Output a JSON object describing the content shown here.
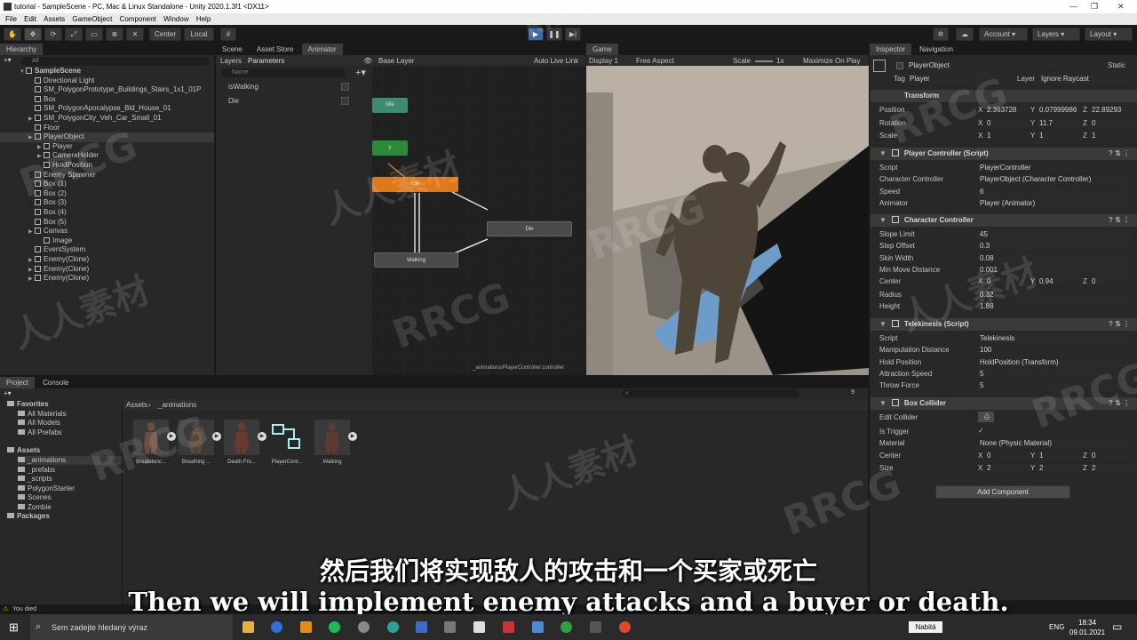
{
  "window_title": "tutorial - SampleScene - PC, Mac & Linux Standalone - Unity 2020.1.3f1 <DX11>",
  "menu": [
    "File",
    "Edit",
    "Assets",
    "GameObject",
    "Component",
    "Window",
    "Help"
  ],
  "toolbar": {
    "center": "Center",
    "local": "Local",
    "account": "Account",
    "layers": "Layers",
    "layout": "Layout"
  },
  "hierarchy": {
    "tab": "Hierarchy",
    "search": "All",
    "scene": "SampleScene",
    "items": [
      "Directional Light",
      "SM_PolygonPrototype_Buildings_Stairs_1x1_01P",
      "Box",
      "SM_PolygonApocalypse_Bld_House_01",
      "SM_PolygonCity_Veh_Car_Small_01",
      "Floor",
      "PlayerObject",
      "Player",
      "CameraHolder",
      "HoldPosition",
      "Enemy Spawner",
      "Box (1)",
      "Box (2)",
      "Box (3)",
      "Box (4)",
      "Box (5)",
      "Canvas",
      "Image",
      "EventSystem",
      "Enemy(Clone)",
      "Enemy(Clone)",
      "Enemy(Clone)"
    ]
  },
  "animator": {
    "tabs": [
      "Scene",
      "Asset Store",
      "Animator"
    ],
    "sub_tabs": [
      "Layers",
      "Parameters"
    ],
    "base_layer": "Base Layer",
    "auto_live": "Auto Live Link",
    "search_placeholder": "Name",
    "params": [
      "isWalking",
      "Die"
    ],
    "nodes": {
      "entry": "Idle",
      "idle": "Idle",
      "die": "Die",
      "walking": "Walking",
      "any": "y"
    },
    "footer": "_animations/PlayerController.controller"
  },
  "game": {
    "tab": "Game",
    "display": "Display 1",
    "aspect": "Free Aspect",
    "scale_label": "Scale",
    "scale_val": "1x",
    "maximize": "Maximize On Play"
  },
  "inspector": {
    "tabs": [
      "Inspector",
      "Navigation"
    ],
    "object_name": "PlayerObject",
    "static": "Static",
    "tag_label": "Tag",
    "tag": "Player",
    "layer_label": "Layer",
    "layer": "Ignore Raycast",
    "transform": {
      "title": "Transform",
      "position": [
        "2.363728",
        "0.07999986",
        "22.89293"
      ],
      "rotation": [
        "0",
        "11.7",
        "0"
      ],
      "scale": [
        "1",
        "1",
        "1"
      ],
      "labels": [
        "Position",
        "Rotation",
        "Scale"
      ]
    },
    "player_controller": {
      "title": "Player Controller (Script)",
      "rows": [
        [
          "Script",
          "PlayerController"
        ],
        [
          "Character Controller",
          "PlayerObject (Character Controller)"
        ],
        [
          "Speed",
          "6"
        ],
        [
          "Animator",
          "Player (Animator)"
        ]
      ]
    },
    "character_controller": {
      "title": "Character Controller",
      "rows": [
        [
          "Slope Limit",
          "45"
        ],
        [
          "Step Offset",
          "0.3"
        ],
        [
          "Skin Width",
          "0.08"
        ],
        [
          "Min Move Distance",
          "0.001"
        ]
      ],
      "center": [
        "0",
        "0.94",
        "0"
      ],
      "center_label": "Center",
      "radius": [
        "Radius",
        "0.32"
      ],
      "height": [
        "Height",
        "1.88"
      ]
    },
    "telekinesis": {
      "title": "Telekinesis (Script)",
      "rows": [
        [
          "Script",
          "Telekinesis"
        ],
        [
          "Manipulation Distance",
          "100"
        ],
        [
          "Hold Position",
          "HoldPosition (Transform)"
        ],
        [
          "Attraction Speed",
          "5"
        ],
        [
          "Throw Force",
          "5"
        ]
      ]
    },
    "box_collider": {
      "title": "Box Collider",
      "edit": "Edit Collider",
      "trigger": "Is Trigger",
      "material_label": "Material",
      "material": "None (Physic Material)",
      "center_label": "Center",
      "center": [
        "0",
        "1",
        "0"
      ],
      "size_label": "Size",
      "size": [
        "2",
        "2",
        "2"
      ]
    },
    "add_component": "Add Component"
  },
  "project": {
    "tabs": [
      "Project",
      "Console"
    ],
    "favorites": "Favorites",
    "fav_items": [
      "All Materials",
      "All Models",
      "All Prefabs"
    ],
    "assets": "Assets",
    "folders": [
      "_animations",
      "_prefabs",
      "_scripts",
      "PolygonStarter",
      "Scenes",
      "Zombie"
    ],
    "packages": "Packages",
    "breadcrumb": [
      "Assets",
      "_animations"
    ],
    "files": [
      "Breakdanc...",
      "Breathing ...",
      "Death Fro...",
      "PlayerCont...",
      "Walking"
    ],
    "count": "9"
  },
  "status": "You died",
  "subtitle_cn": "然后我们将实现敌人的攻击和一个买家或死亡",
  "subtitle_en": "Then we will implement enemy attacks and a buyer or death.",
  "taskbar": {
    "search": "Sem zadejte hledaný výraz",
    "nabita": "Nabitá",
    "lang": "ENG",
    "time": "18:34",
    "date": "09.01.2021"
  },
  "watermark": "RRCG",
  "watermark_cn": "人人素材"
}
